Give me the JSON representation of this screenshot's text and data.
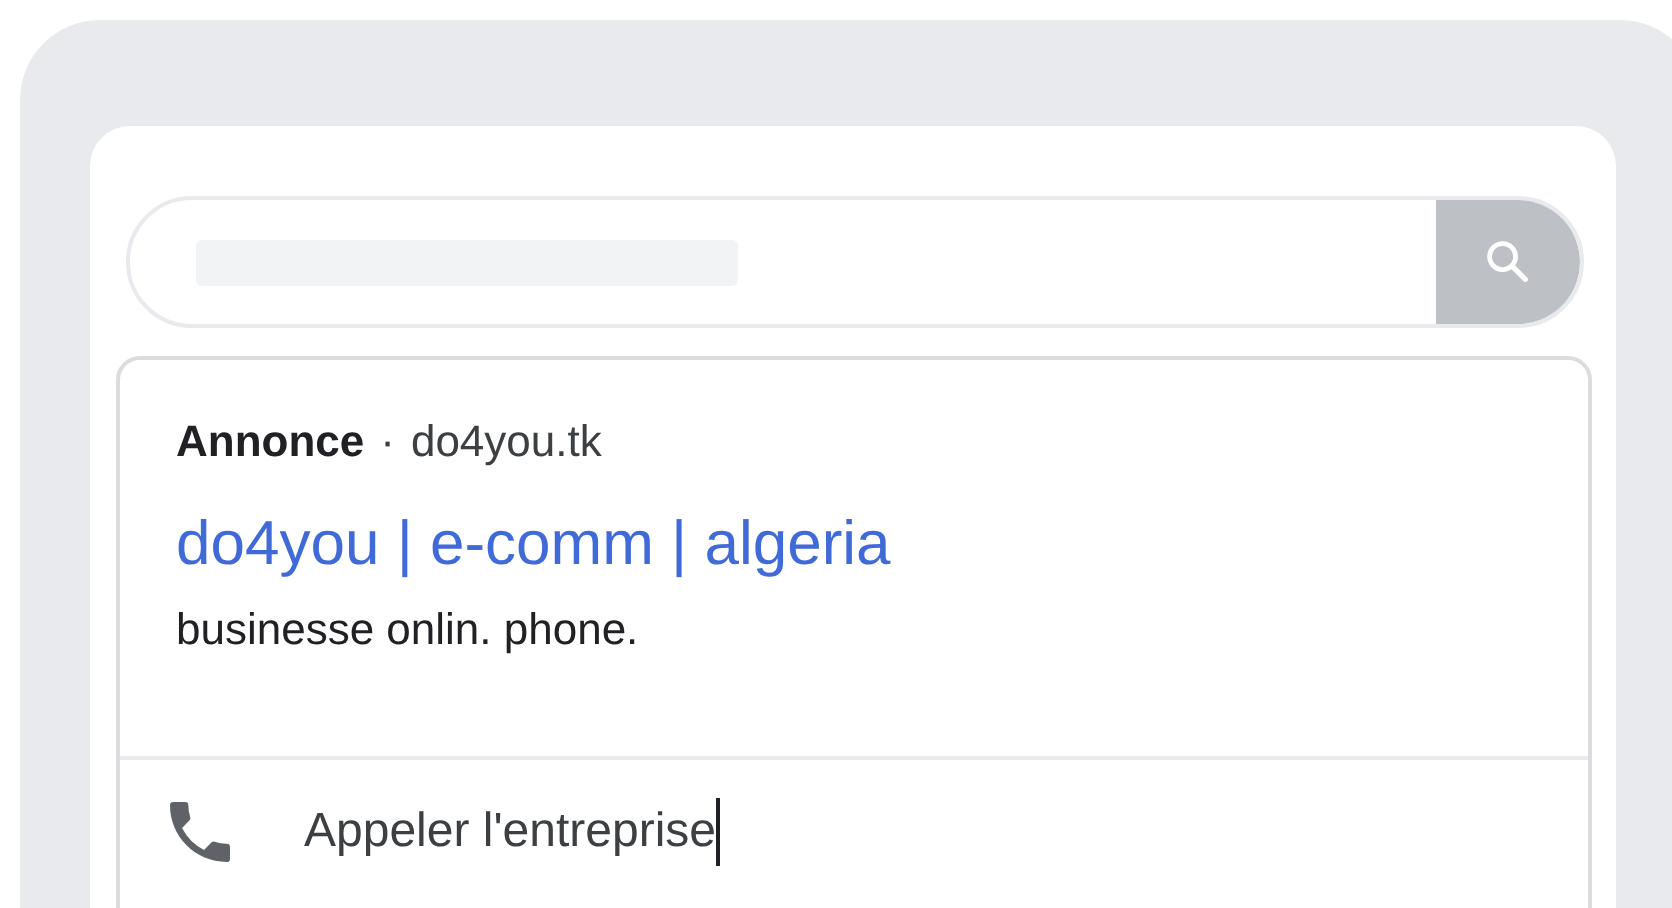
{
  "ad": {
    "label": "Annonce",
    "separator": "·",
    "domain": "do4you.tk",
    "title": "do4you | e-comm | algeria",
    "description": "businesse onlin. phone.",
    "call_action": "Appeler l'entreprise"
  }
}
